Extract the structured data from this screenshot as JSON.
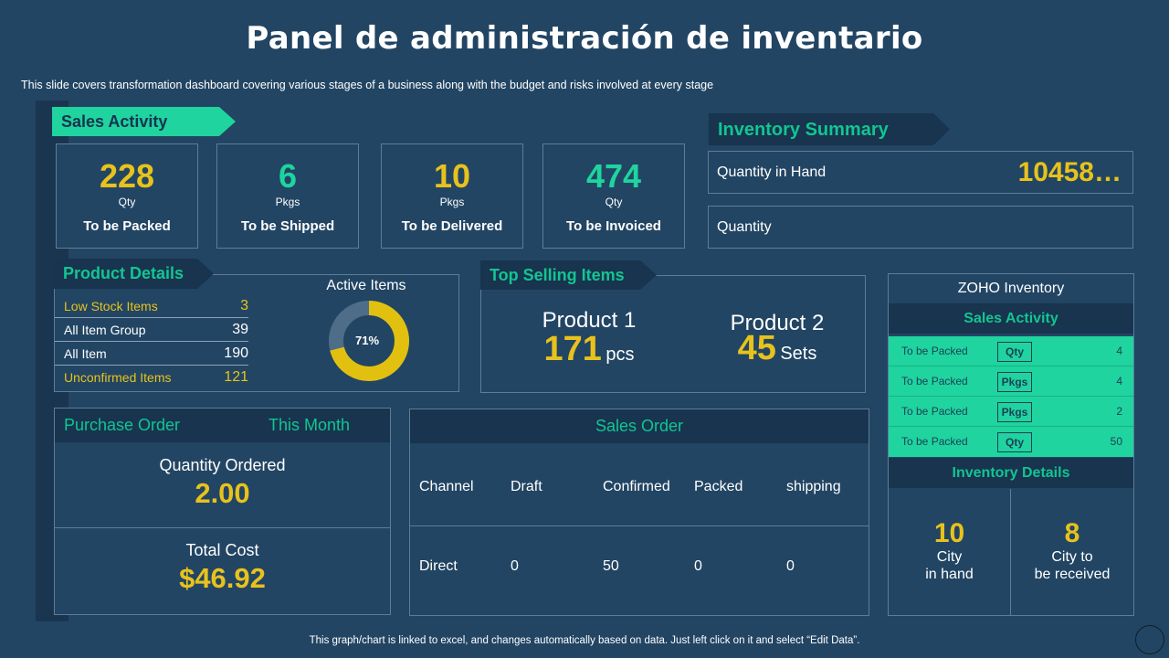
{
  "title": "Panel de administración de inventario",
  "subtitle": "This slide covers transformation dashboard covering various stages of a business along with the budget and risks involved at every stage",
  "footer": "This graph/chart is linked to excel, and changes automatically based on data. Just left click on it and select “Edit Data”.",
  "colors": {
    "background": "#224563",
    "accent_green": "#1fd49e",
    "accent_yellow": "#e8c21c",
    "dark_panel": "#18344e"
  },
  "sales_activity": {
    "heading": "Sales Activity",
    "cards": [
      {
        "value": "228",
        "unit": "Qty",
        "label": "To be Packed",
        "color": "yellow"
      },
      {
        "value": "6",
        "unit": "Pkgs",
        "label": "To be Shipped",
        "color": "green"
      },
      {
        "value": "10",
        "unit": "Pkgs",
        "label": "To be Delivered",
        "color": "yellow"
      },
      {
        "value": "474",
        "unit": "Qty",
        "label": "To be Invoiced",
        "color": "green"
      }
    ]
  },
  "inventory_summary": {
    "heading": "Inventory Summary",
    "rows": [
      {
        "label": "Quantity in Hand",
        "value": "10458…"
      },
      {
        "label": "Quantity",
        "value": ""
      }
    ]
  },
  "product_details": {
    "heading": "Product Details",
    "rows": [
      {
        "label": "Low Stock Items",
        "value": "3",
        "highlight": true
      },
      {
        "label": "All Item Group",
        "value": "39",
        "highlight": false
      },
      {
        "label": "All Item",
        "value": "190",
        "highlight": false
      },
      {
        "label": "Unconfirmed Items",
        "value": "121",
        "highlight": true
      }
    ],
    "active_items": {
      "title": "Active Items",
      "percent_label": "71%",
      "percent": 71
    }
  },
  "top_selling": {
    "heading": "Top Selling Items",
    "products": [
      {
        "name": "Product  1",
        "value": "171",
        "unit": "pcs"
      },
      {
        "name": "Product  2",
        "value": "45",
        "unit": "Sets"
      }
    ]
  },
  "zoho": {
    "title": "ZOHO Inventory",
    "sales_heading": "Sales Activity",
    "rows": [
      {
        "label": "To be Packed",
        "badge": "Qty",
        "count": "4"
      },
      {
        "label": "To be Packed",
        "badge": "Pkgs",
        "count": "4"
      },
      {
        "label": "To be Packed",
        "badge": "Pkgs",
        "count": "2"
      },
      {
        "label": "To be Packed",
        "badge": "Qty",
        "count": "50"
      }
    ],
    "details_heading": "Inventory Details",
    "details": [
      {
        "value": "10",
        "line1": "City",
        "line2": "in hand"
      },
      {
        "value": "8",
        "line1": "City to",
        "line2": "be received"
      }
    ]
  },
  "purchase_order": {
    "heading": "Purchase Order",
    "period": "This Month",
    "qty_label": "Quantity Ordered",
    "qty_value": "2.00",
    "cost_label": "Total Cost",
    "cost_value": "$46.92"
  },
  "sales_order": {
    "heading": "Sales Order",
    "columns": [
      "Channel",
      "Draft",
      "Confirmed",
      "Packed",
      "shipping"
    ],
    "rows": [
      [
        "Direct",
        "0",
        "50",
        "0",
        "0"
      ]
    ]
  }
}
